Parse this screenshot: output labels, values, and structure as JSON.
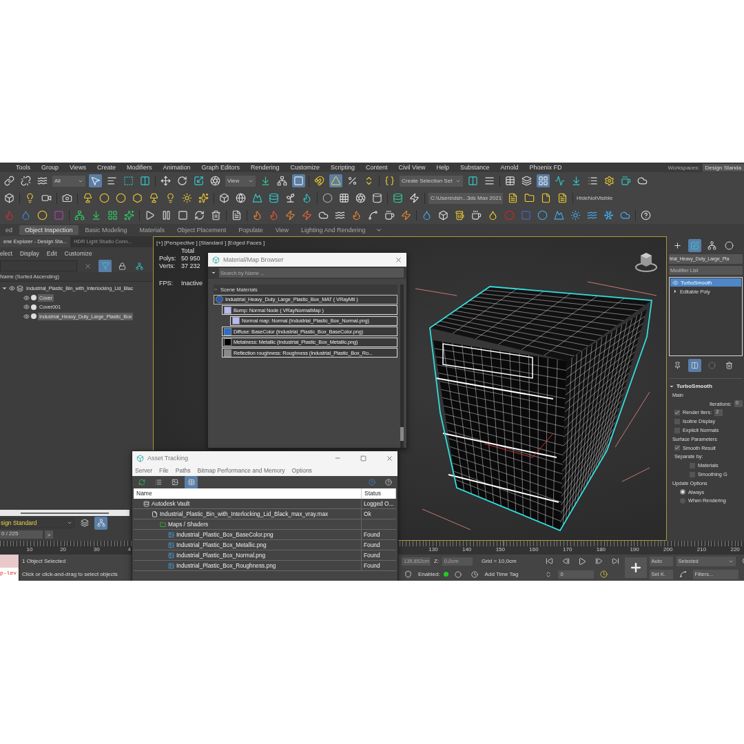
{
  "menu_bar": {
    "items": [
      "Tools",
      "Group",
      "Views",
      "Create",
      "Modifiers",
      "Animation",
      "Graph Editors",
      "Rendering",
      "Customize",
      "Scripting",
      "Content",
      "Civil View",
      "Help",
      "Substance",
      "Arnold",
      "Phoenix FD"
    ],
    "workspaces_label": "Workspaces:",
    "workspace": "Design Standa"
  },
  "toolbar": {
    "selection_filter": "All",
    "reference_coord": "View",
    "selection_set": "Create Selection Set",
    "project_path": "C:\\Users\\dsh...3ds Max 2021",
    "script_button": "HideNotVisible"
  },
  "ribbon_tabs": [
    {
      "label": "ed",
      "selected": false
    },
    {
      "label": "Object Inspection",
      "selected": true
    },
    {
      "label": "Basic Modeling",
      "selected": false
    },
    {
      "label": "Materials",
      "selected": false
    },
    {
      "label": "Object Placement",
      "selected": false
    },
    {
      "label": "Populate",
      "selected": false
    },
    {
      "label": "View",
      "selected": false
    },
    {
      "label": "Lighting And Rendering",
      "selected": false
    }
  ],
  "scene_explorer": {
    "tabs": [
      {
        "label": "ene Explorer - Design Sta...",
        "selected": true
      },
      {
        "label": "HDR Light Studio Conn...",
        "selected": false
      }
    ],
    "menu": [
      "elect",
      "Display",
      "Edit",
      "Customize"
    ],
    "column": "Name (Sorted Ascending)",
    "tree": [
      {
        "label": "Industrial_Plastic_Bin_with_Interlocking_Lid_Blac",
        "expanded": true,
        "selected": false,
        "children": [
          {
            "label": "Cover",
            "selected": true
          },
          {
            "label": "Cover001",
            "selected": false
          },
          {
            "label": "Industrial_Heavy_Duty_Large_Plastic_Box",
            "selected": true
          }
        ]
      }
    ],
    "layer": "sign Standard",
    "frame_counter": "0 / 225",
    "next_button": ">"
  },
  "viewport": {
    "label": "[+] [Perspective ] [Standard ] [Edged Faces ]",
    "stats_header": "Total",
    "stats": [
      {
        "label": "Polys:",
        "value": "50 950"
      },
      {
        "label": "Verts:",
        "value": "37 232"
      },
      {
        "label": "FPS:",
        "value": "Inactive"
      }
    ]
  },
  "command_panel": {
    "object_name": "trial_Heavy_Duty_Large_Pla",
    "modifier_list": "Modifier List",
    "stack": [
      {
        "label": "TurboSmooth",
        "selected": true,
        "kind": "modifier"
      },
      {
        "label": "Editable Poly",
        "selected": false,
        "kind": "base"
      }
    ],
    "rollout": {
      "title": "TurboSmooth",
      "expanded": true,
      "rows": [
        {
          "kind": "group",
          "label": "Main"
        },
        {
          "kind": "spinner",
          "label": "Iterations:",
          "value": "0"
        },
        {
          "kind": "check_spinner",
          "label": "Render Iters:",
          "checked": true,
          "value": "2"
        },
        {
          "kind": "checkbox",
          "label": "Isoline Display",
          "checked": false
        },
        {
          "kind": "checkbox",
          "label": "Explicit Normals",
          "checked": false
        },
        {
          "kind": "group",
          "label": "Surface Parameters"
        },
        {
          "kind": "checkbox",
          "label": "Smooth Result",
          "checked": true
        },
        {
          "kind": "text",
          "label": "Separate by:"
        },
        {
          "kind": "sub_checkbox",
          "label": "Materials",
          "checked": false
        },
        {
          "kind": "sub_checkbox",
          "label": "Smoothing G",
          "checked": false
        },
        {
          "kind": "group",
          "label": "Update Options"
        },
        {
          "kind": "radio",
          "label": "Always",
          "selected": true
        },
        {
          "kind": "radio",
          "label": "When Rendering",
          "selected": false
        }
      ]
    }
  },
  "material_browser": {
    "title": "Material/Map Browser",
    "search_placeholder": "Search by Name ...",
    "group": {
      "label": "Scene Materials",
      "expanded": true
    },
    "materials": [
      {
        "label": "Industrial_Heavy_Duty_Large_Plastic_Box_MAT  ( VRayMtl )",
        "kind": "material",
        "children": [
          {
            "label": "Bump: Normal Node  ( VRayNormalMap )",
            "kind": "swatch",
            "children": [
              {
                "label": "Normal map: Normal (Industrial_Plastic_Box_Normal.png)",
                "kind": "swatch"
              }
            ]
          },
          {
            "label": "Diffuse: BaseColor (Industrial_Plastic_Box_BaseColor.png)",
            "kind": "bitmap"
          },
          {
            "label": "Metalness: Metallic (Industrial_Plastic_Box_Metallic.png)",
            "kind": "black"
          },
          {
            "label": "Reflection  roughness:  Roughness  (Industrial_Plastic_Box_Ro...",
            "kind": "grey"
          }
        ]
      }
    ]
  },
  "asset_tracking": {
    "title": "Asset Tracking",
    "menu": [
      "Server",
      "File",
      "Paths",
      "Bitmap Performance and Memory",
      "Options"
    ],
    "columns": [
      "Name",
      "Status"
    ],
    "rows": [
      {
        "name": "Autodesk Vault",
        "status": "Logged O...",
        "kind": "vault",
        "children": [
          {
            "name": "Industrial_Plastic_Bin_with_Interlocking_Lid_Black_max_vray.max",
            "status": "Ok",
            "kind": "file",
            "children": [
              {
                "name": "Maps / Shaders",
                "kind": "folder",
                "children": [
                  {
                    "name": "Industrial_Plastic_Box_BaseColor.png",
                    "status": "Found",
                    "kind": "image"
                  },
                  {
                    "name": "Industrial_Plastic_Box_Metallic.png",
                    "status": "Found",
                    "kind": "image"
                  },
                  {
                    "name": "Industrial_Plastic_Box_Normal.png",
                    "status": "Found",
                    "kind": "image"
                  },
                  {
                    "name": "Industrial_Plastic_Box_Roughness.png",
                    "status": "Found",
                    "kind": "image"
                  }
                ]
              }
            ]
          }
        ]
      }
    ]
  },
  "timeline": {
    "left_ticks": [
      "10",
      "20",
      "30",
      "4"
    ],
    "right_ticks": [
      "130",
      "140",
      "150",
      "160",
      "170",
      "180",
      "190",
      "200",
      "210",
      "220"
    ]
  },
  "status_bar": {
    "listener": "p-lev",
    "messages": [
      "1 Object Selected",
      "Click or click-and-drag to select objects"
    ],
    "x_value": "135,852cm",
    "z_label": "Z:",
    "z_value": "0,0cm",
    "grid": "Grid = 10,0cm",
    "enabled_label": "Enabled:",
    "enabled": true,
    "time_tag": "Add Time Tag",
    "frame": "0",
    "auto_key": "Auto",
    "set_key": "Set K.",
    "key_filter": "Selected",
    "filters": "Filters..."
  }
}
